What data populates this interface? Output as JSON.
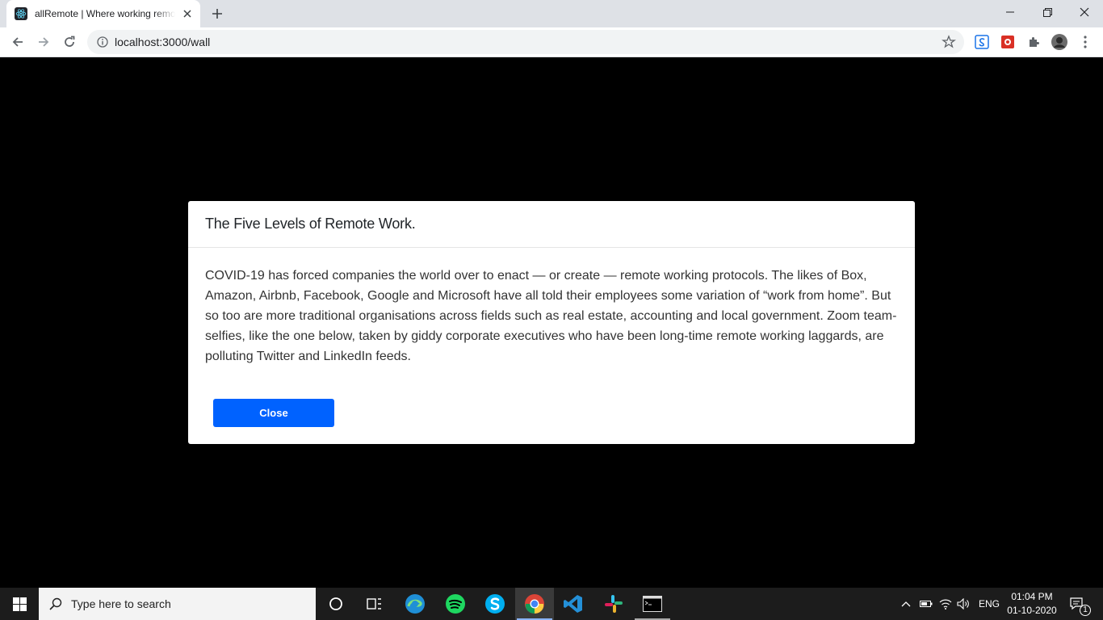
{
  "browser": {
    "tab_title": "allRemote | Where working remotely",
    "url": "localhost:3000/wall",
    "new_tab_icon": "plus-icon",
    "window_controls": [
      "minimize-icon",
      "restore-icon",
      "close-icon"
    ],
    "extensions": [
      "sync-extension",
      "red-extension",
      "puzzle-icon",
      "profile-avatar"
    ]
  },
  "modal": {
    "title": "The Five Levels of Remote Work.",
    "body": "COVID-19 has forced companies the world over to enact — or create — remote working protocols. The likes of Box, Amazon, Airbnb, Facebook, Google and Microsoft have all told their employees some variation of “work from home”. But so too are more traditional organisations across fields such as real estate, accounting and local government. Zoom team-selfies, like the one below, taken by giddy corporate executives who have been long-time remote working laggards, are polluting Twitter and LinkedIn feeds.",
    "close_label": "Close",
    "accent_color": "#0062ff"
  },
  "taskbar": {
    "search_placeholder": "Type here to search",
    "apps": [
      "cortana-icon",
      "task-view-icon",
      "edge-icon",
      "spotify-icon",
      "skype-icon",
      "chrome-icon",
      "vscode-icon",
      "slack-icon",
      "terminal-icon"
    ],
    "language": "ENG",
    "time": "01:04 PM",
    "date": "01-10-2020",
    "notification_count": "1"
  }
}
